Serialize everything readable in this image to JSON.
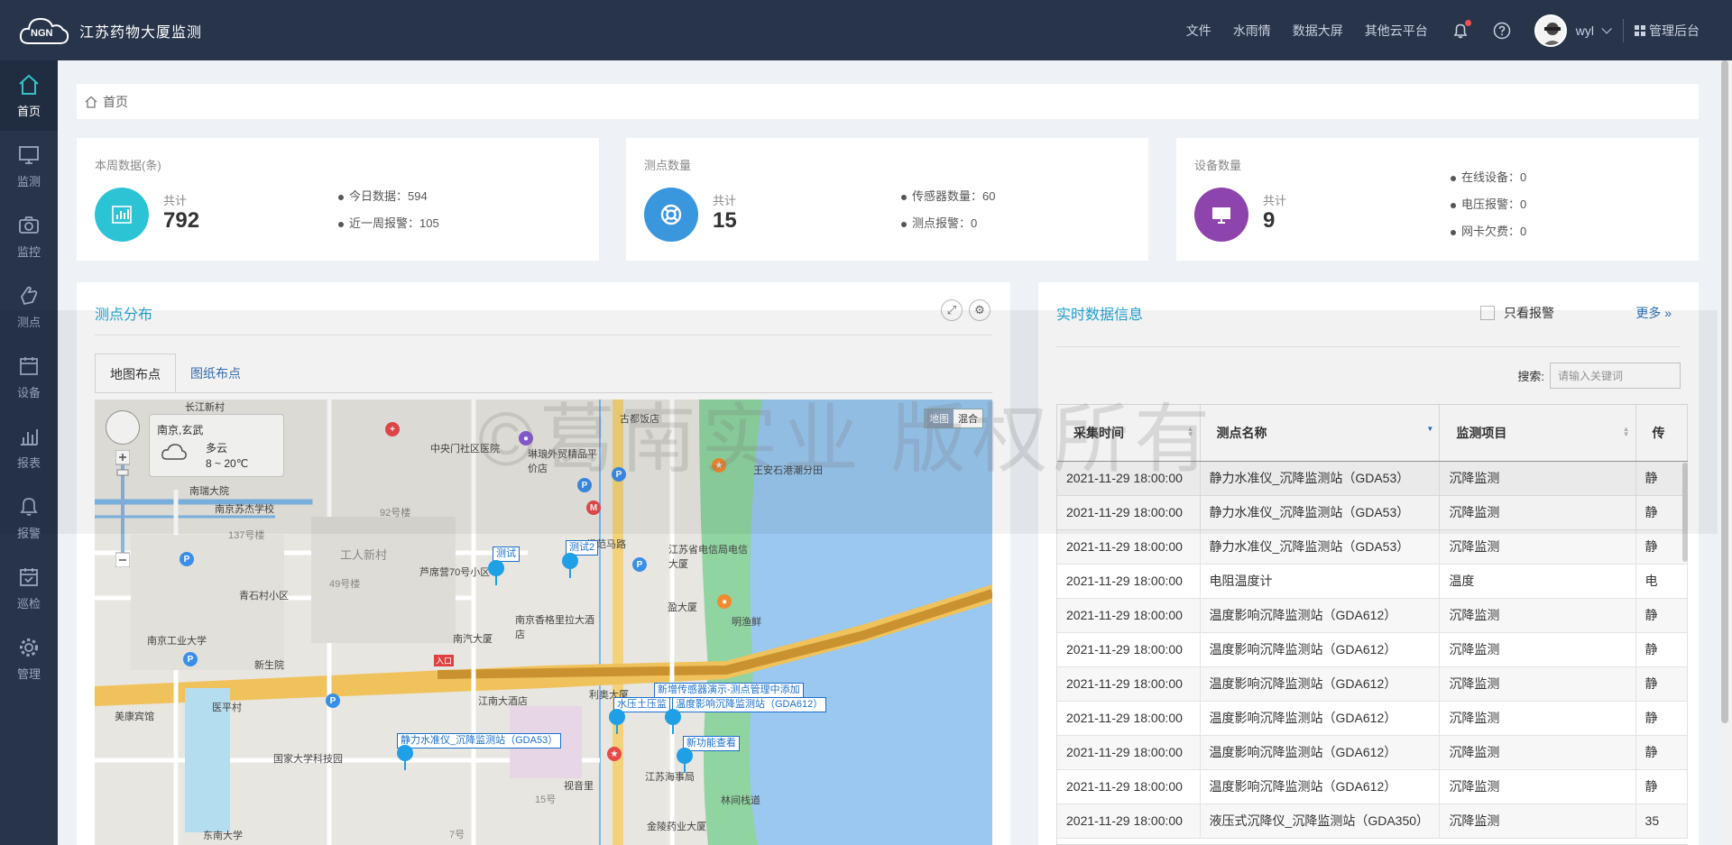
{
  "header": {
    "title": "江苏药物大厦监测",
    "logo_text": "NGN",
    "nav": [
      "文件",
      "水雨情",
      "数据大屏",
      "其他云平台"
    ],
    "username": "wyl",
    "admin_label": "管理后台"
  },
  "sidebar": {
    "items": [
      {
        "label": "首页",
        "icon": "home-icon"
      },
      {
        "label": "监测",
        "icon": "monitor-icon"
      },
      {
        "label": "监控",
        "icon": "camera-icon"
      },
      {
        "label": "测点",
        "icon": "hand-icon"
      },
      {
        "label": "设备",
        "icon": "calendar-icon"
      },
      {
        "label": "报表",
        "icon": "bar-chart-icon"
      },
      {
        "label": "报警",
        "icon": "bell-icon"
      },
      {
        "label": "巡检",
        "icon": "check-calendar-icon"
      },
      {
        "label": "管理",
        "icon": "gear-icon"
      }
    ]
  },
  "breadcrumb": {
    "home": "首页"
  },
  "stats": {
    "week": {
      "title": "本周数据(条)",
      "label": "共计",
      "value": "792",
      "items": [
        "今日数据：594",
        "近一周报警：105"
      ],
      "color": "#2cc3d5"
    },
    "points": {
      "title": "测点数量",
      "label": "共计",
      "value": "15",
      "items": [
        "传感器数量：60",
        "测点报警：0"
      ],
      "color": "#3a96dd"
    },
    "devices": {
      "title": "设备数量",
      "label": "共计",
      "value": "9",
      "items": [
        "在线设备：0",
        "电压报警：0",
        "网卡欠费：0"
      ],
      "color": "#8e44ad"
    }
  },
  "distribution": {
    "title": "测点分布",
    "tabs": [
      "地图布点",
      "图纸布点"
    ],
    "map": {
      "switch_map": "地图",
      "switch_hybrid": "混合",
      "city": "南京,玄武",
      "weather": "多云",
      "temp": "8 ~ 20℃",
      "labels": [
        "长江新村",
        "古都饭店",
        "中央门社区医院",
        "琳琅外贸精品平价店",
        "王安石港潮分田",
        "南瑞大院",
        "南京苏杰学校",
        "92号楼",
        "137号楼",
        "工人新村",
        "芦席营70号小区",
        "南京香格里拉大酒店",
        "江苏省电信局电信大厦",
        "49号楼",
        "青石村小区",
        "南汽大厦",
        "南京工业大学",
        "新生院",
        "明渔鲜",
        "模范马路",
        "江南大酒店",
        "利奥大厦",
        "美康宾馆",
        "医平村",
        "国家大学科技园",
        "视音里",
        "江苏海事局",
        "林间栈道",
        "金陵药业大厦",
        "东南大学",
        "盈大厦",
        "入口",
        "15号",
        "7号"
      ],
      "tags": [
        "测试",
        "测试2",
        "静力水准仪_沉降监测站（GDA53）",
        "水压土压监",
        "温度影响沉降监测站（GDA612）",
        "新增传感器演示-测点管理中添加",
        "新功能查看"
      ]
    }
  },
  "realtime": {
    "title": "实时数据信息",
    "only_alarm": "只看报警",
    "more": "更多 »",
    "search_label": "搜索:",
    "search_placeholder": "请输入关键词",
    "columns": [
      "采集时间",
      "测点名称",
      "监测项目",
      "传"
    ],
    "rows": [
      [
        "2021-11-29 18:00:00",
        "静力水准仪_沉降监测站（GDA53）",
        "沉降监测",
        "静"
      ],
      [
        "2021-11-29 18:00:00",
        "静力水准仪_沉降监测站（GDA53）",
        "沉降监测",
        "静"
      ],
      [
        "2021-11-29 18:00:00",
        "静力水准仪_沉降监测站（GDA53）",
        "沉降监测",
        "静"
      ],
      [
        "2021-11-29 18:00:00",
        "电阻温度计",
        "温度",
        "电"
      ],
      [
        "2021-11-29 18:00:00",
        "温度影响沉降监测站（GDA612）",
        "沉降监测",
        "静"
      ],
      [
        "2021-11-29 18:00:00",
        "温度影响沉降监测站（GDA612）",
        "沉降监测",
        "静"
      ],
      [
        "2021-11-29 18:00:00",
        "温度影响沉降监测站（GDA612）",
        "沉降监测",
        "静"
      ],
      [
        "2021-11-29 18:00:00",
        "温度影响沉降监测站（GDA612）",
        "沉降监测",
        "静"
      ],
      [
        "2021-11-29 18:00:00",
        "温度影响沉降监测站（GDA612）",
        "沉降监测",
        "静"
      ],
      [
        "2021-11-29 18:00:00",
        "温度影响沉降监测站（GDA612）",
        "沉降监测",
        "静"
      ],
      [
        "2021-11-29 18:00:00",
        "液压式沉降仪_沉降监测站（GDA350）",
        "沉降监测",
        "35"
      ]
    ]
  },
  "watermark": "©葛南实业 版权所有"
}
